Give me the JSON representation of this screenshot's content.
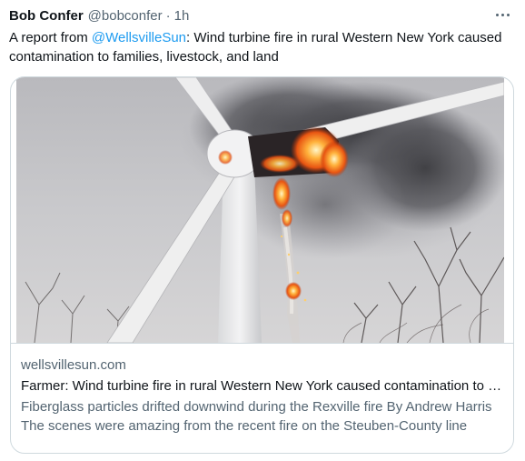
{
  "tweet": {
    "author_name": "Bob Confer",
    "author_handle": "@bobconfer",
    "separator": "·",
    "time": "1h",
    "more_icon": "more-horizontal-icon",
    "text_before": "A report from ",
    "mention": "@WellsvilleSun",
    "text_after": ": Wind turbine fire in rural Western New York caused contamination to families, livestock, and land"
  },
  "card": {
    "image_description": "wind-turbine-fire-photo",
    "domain": "wellsvillesun.com",
    "title": "Farmer: Wind turbine fire in rural Western New York caused contamination to families, livestock, and land",
    "description": "Fiberglass particles drifted downwind during the Rexville fire By Andrew Harris The scenes were amazing from the recent fire on the Steuben-County line"
  },
  "colors": {
    "text_primary": "#0f1419",
    "text_secondary": "#536471",
    "link": "#1d9bf0",
    "border": "#cfd9de"
  }
}
